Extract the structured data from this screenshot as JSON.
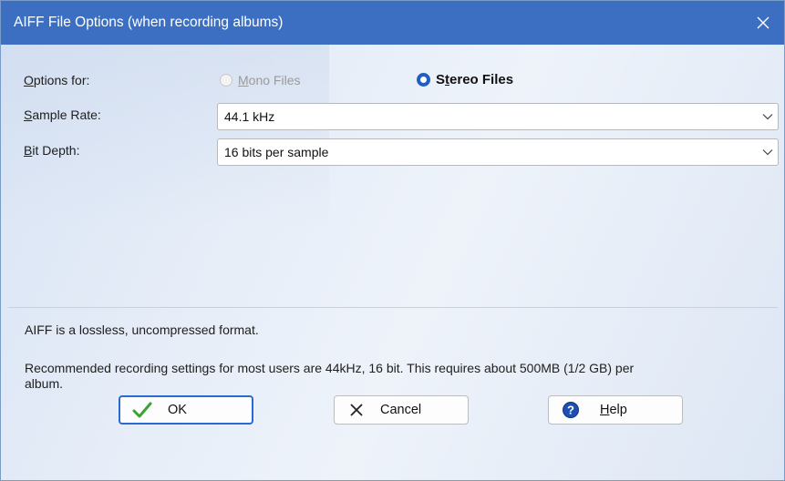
{
  "window": {
    "title": "AIFF File Options (when recording albums)",
    "close_icon": "close-icon"
  },
  "options": {
    "options_for_label": "Options for:",
    "mono_label": "Mono Files",
    "mono_enabled": false,
    "stereo_label": "Stereo Files",
    "stereo_selected": true
  },
  "sample_rate": {
    "label": "Sample Rate:",
    "value": "44.1 kHz"
  },
  "bit_depth": {
    "label": "Bit Depth:",
    "value": "16 bits per sample"
  },
  "info": {
    "line1": "AIFF is a lossless, uncompressed format.",
    "line2": "Recommended recording settings for most users are 44kHz, 16 bit.  This requires about 500MB (1/2 GB) per",
    "line3": "album."
  },
  "buttons": {
    "ok_label": "OK",
    "cancel_label": "Cancel",
    "help_label": "Help"
  },
  "colors": {
    "titlebar": "#3c6fc1",
    "accent": "#2b6bd1",
    "ok_check": "#3aa335"
  }
}
